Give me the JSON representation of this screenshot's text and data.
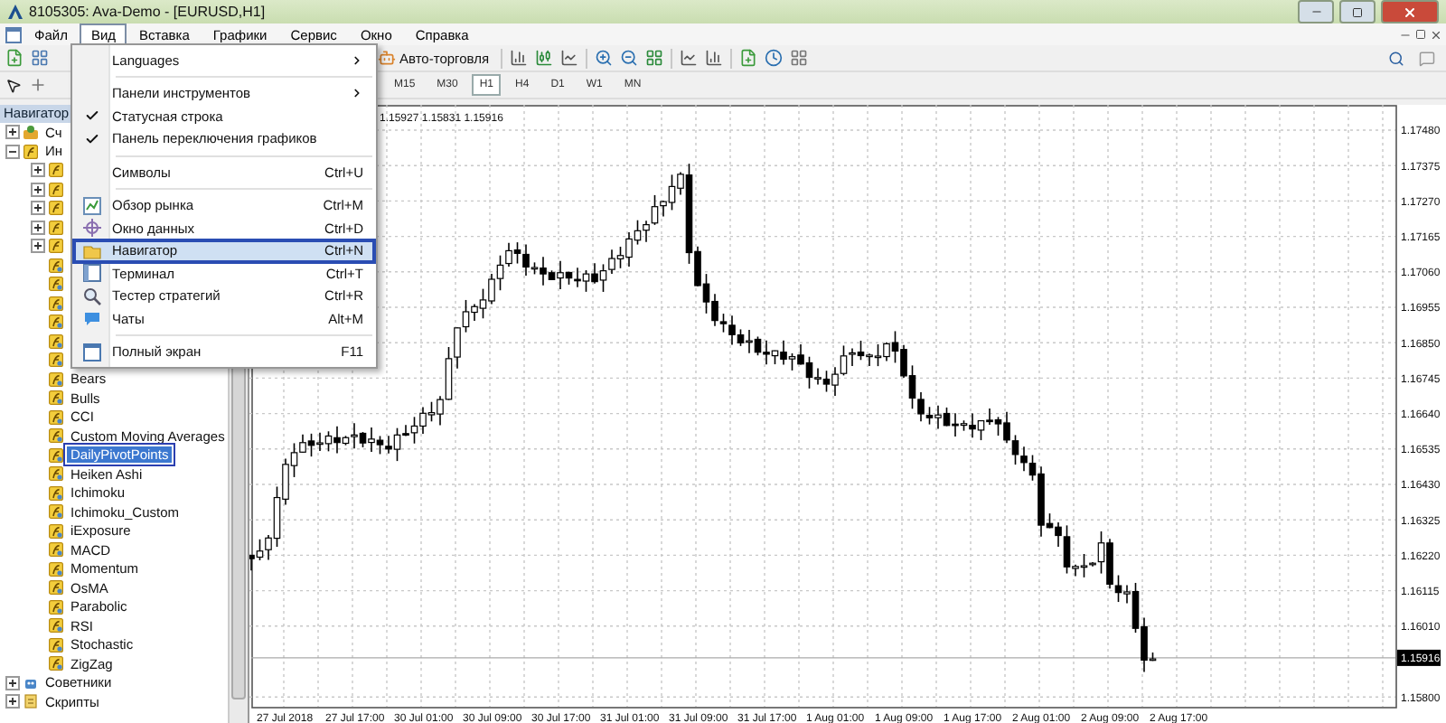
{
  "window": {
    "title": "8105305: Ava-Demo - [EURUSD,H1]"
  },
  "menu_bar": [
    {
      "label": "Файл",
      "selected": false
    },
    {
      "label": "Вид",
      "selected": true
    },
    {
      "label": "Вставка",
      "selected": false
    },
    {
      "label": "Графики",
      "selected": false
    },
    {
      "label": "Сервис",
      "selected": false
    },
    {
      "label": "Окно",
      "selected": false
    },
    {
      "label": "Справка",
      "selected": false
    }
  ],
  "view_menu": [
    {
      "kind": "submenu",
      "label": "Languages"
    },
    {
      "kind": "separator"
    },
    {
      "kind": "submenu",
      "label": "Панели инструментов"
    },
    {
      "kind": "check",
      "label": "Статусная строка",
      "checked": true
    },
    {
      "kind": "check",
      "label": "Панель переключения графиков",
      "checked": true
    },
    {
      "kind": "separator"
    },
    {
      "kind": "item",
      "label": "Символы",
      "shortcut": "Ctrl+U",
      "selected": false
    },
    {
      "kind": "separator"
    },
    {
      "kind": "icon",
      "label": "Обзор рынка",
      "shortcut": "Ctrl+M",
      "selected": false
    },
    {
      "kind": "icon",
      "label": "Окно данных",
      "shortcut": "Ctrl+D",
      "selected": false
    },
    {
      "kind": "icon",
      "label": "Навигатор",
      "shortcut": "Ctrl+N",
      "selected": true
    },
    {
      "kind": "icon",
      "label": "Терминал",
      "shortcut": "Ctrl+T",
      "selected": false
    },
    {
      "kind": "icon",
      "label": "Тестер стратегий",
      "shortcut": "Ctrl+R",
      "selected": false
    },
    {
      "kind": "icon",
      "label": "Чаты",
      "shortcut": "Alt+M",
      "selected": false
    },
    {
      "kind": "separator"
    },
    {
      "kind": "icon",
      "label": "Полный экран",
      "shortcut": "F11",
      "selected": false
    }
  ],
  "toolbar": {
    "auto_trading": "Авто-торговля"
  },
  "timeframes": [
    {
      "label": "M15",
      "selected": false
    },
    {
      "label": "M30",
      "selected": false
    },
    {
      "label": "H1",
      "selected": true
    },
    {
      "label": "H4",
      "selected": false
    },
    {
      "label": "D1",
      "selected": false
    },
    {
      "label": "W1",
      "selected": false
    },
    {
      "label": "MN",
      "selected": false
    }
  ],
  "navigator": {
    "title": "Навигатор",
    "tree": [
      {
        "kind": "accounts",
        "label": "Сч",
        "expanded": false,
        "selected": false
      },
      {
        "kind": "indicators",
        "label": "Ин",
        "expanded": true,
        "selected": false,
        "children": [
          {
            "kind": "folder",
            "expanded": false
          },
          {
            "kind": "folder",
            "expanded": false
          },
          {
            "kind": "folder",
            "expanded": false
          },
          {
            "kind": "folder",
            "expanded": false
          },
          {
            "kind": "folder",
            "expanded": false
          },
          {
            "kind": "indicator"
          },
          {
            "kind": "indicator"
          },
          {
            "kind": "indicator"
          },
          {
            "kind": "indicator"
          },
          {
            "kind": "indicator"
          },
          {
            "kind": "indicator"
          },
          {
            "kind": "indicator",
            "label": "Bears",
            "selected": false
          },
          {
            "kind": "indicator",
            "label": "Bulls",
            "selected": false
          },
          {
            "kind": "indicator",
            "label": "CCI",
            "selected": false
          },
          {
            "kind": "indicator",
            "label": "Custom Moving Averages",
            "selected": false
          },
          {
            "kind": "indicator",
            "label": "DailyPivotPoints",
            "selected": true
          },
          {
            "kind": "indicator",
            "label": "Heiken Ashi",
            "selected": false
          },
          {
            "kind": "indicator",
            "label": "Ichimoku",
            "selected": false
          },
          {
            "kind": "indicator",
            "label": "Ichimoku_Custom",
            "selected": false
          },
          {
            "kind": "indicator",
            "label": "iExposure",
            "selected": false
          },
          {
            "kind": "indicator",
            "label": "MACD",
            "selected": false
          },
          {
            "kind": "indicator",
            "label": "Momentum",
            "selected": false
          },
          {
            "kind": "indicator",
            "label": "OsMA",
            "selected": false
          },
          {
            "kind": "indicator",
            "label": "Parabolic",
            "selected": false
          },
          {
            "kind": "indicator",
            "label": "RSI",
            "selected": false
          },
          {
            "kind": "indicator",
            "label": "Stochastic",
            "selected": false
          },
          {
            "kind": "indicator",
            "label": "ZigZag",
            "selected": false
          }
        ]
      },
      {
        "kind": "experts",
        "label": "Советники",
        "expanded": false,
        "selected": false
      },
      {
        "kind": "scripts",
        "label": "Скрипты",
        "expanded": false,
        "selected": false
      }
    ]
  },
  "chart": {
    "ohlc": "1.15927 1.15831 1.15916",
    "price_labels": [
      "1.17480",
      "1.17375",
      "1.17270",
      "1.17165",
      "1.17060",
      "1.16955",
      "1.16850",
      "1.16745",
      "1.16640",
      "1.16535",
      "1.16430",
      "1.16325",
      "1.16220",
      "1.16115",
      "1.16010",
      "1.15800"
    ],
    "current_price": "1.15916",
    "time_labels": [
      "27 Jul 2018",
      "27 Jul 17:00",
      "30 Jul 01:00",
      "30 Jul 09:00",
      "30 Jul 17:00",
      "31 Jul 01:00",
      "31 Jul 09:00",
      "31 Jul 17:00",
      "1 Aug 01:00",
      "1 Aug 09:00",
      "1 Aug 17:00",
      "2 Aug 01:00",
      "2 Aug 09:00",
      "2 Aug 17:00"
    ]
  }
}
